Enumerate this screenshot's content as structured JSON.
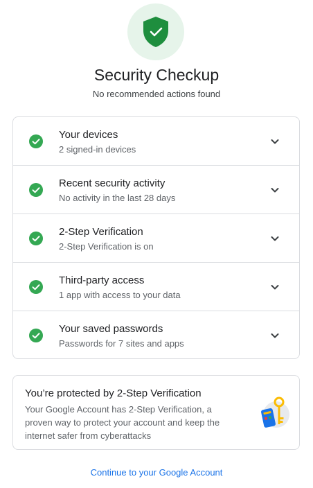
{
  "header": {
    "icon": "shield-check-icon",
    "title": "Security Checkup",
    "subtitle": "No recommended actions found"
  },
  "items": [
    {
      "title": "Your devices",
      "subtitle": "2 signed-in devices",
      "status_icon": "check-circle-icon",
      "expand_icon": "chevron-down-icon"
    },
    {
      "title": "Recent security activity",
      "subtitle": "No activity in the last 28 days",
      "status_icon": "check-circle-icon",
      "expand_icon": "chevron-down-icon"
    },
    {
      "title": "2-Step Verification",
      "subtitle": "2-Step Verification is on",
      "status_icon": "check-circle-icon",
      "expand_icon": "chevron-down-icon"
    },
    {
      "title": "Third-party access",
      "subtitle": "1 app with access to your data",
      "status_icon": "check-circle-icon",
      "expand_icon": "chevron-down-icon"
    },
    {
      "title": "Your saved passwords",
      "subtitle": "Passwords for 7 sites and apps",
      "status_icon": "check-circle-icon",
      "expand_icon": "chevron-down-icon"
    }
  ],
  "promo": {
    "title": "You’re protected by 2-Step Verification",
    "body": "Your Google Account has 2-Step Verification, a proven way to protect your account and keep the internet safer from cyberattacks",
    "illustration": "phone-key-illustration"
  },
  "footer": {
    "link_label": "Continue to your Google Account"
  },
  "colors": {
    "success_green": "#34a853",
    "shield_green": "#1e8e3e",
    "hero_bg": "#e6f4ea",
    "link_blue": "#1a73e8",
    "border": "#dadce0"
  }
}
